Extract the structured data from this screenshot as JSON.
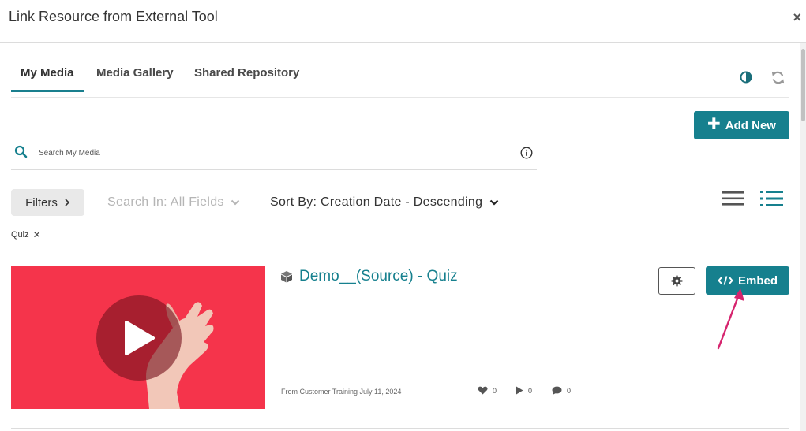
{
  "window": {
    "title": "Link Resource from External Tool",
    "close_label": "×"
  },
  "tabs": [
    {
      "label": "My Media",
      "active": true
    },
    {
      "label": "Media Gallery",
      "active": false
    },
    {
      "label": "Shared Repository",
      "active": false
    }
  ],
  "toolbar": {
    "add_new_label": "Add New",
    "contrast_icon": "contrast-icon",
    "refresh_icon": "refresh-icon"
  },
  "search": {
    "placeholder": "Search My Media",
    "value": ""
  },
  "filters": {
    "filters_label": "Filters",
    "search_in_label": "Search In: All Fields",
    "sort_by_label": "Sort By: Creation Date - Descending"
  },
  "active_filters": [
    {
      "label": "Quiz"
    }
  ],
  "entries": [
    {
      "title": "Demo__(Source) - Quiz",
      "meta": "From Customer Training July 11, 2024",
      "likes": "0",
      "plays": "0",
      "comments": "0",
      "embed_label": "Embed"
    }
  ],
  "colors": {
    "accent": "#16808e",
    "thumbnail_bg": "#f5344b",
    "annotation_arrow": "#d6246e"
  }
}
